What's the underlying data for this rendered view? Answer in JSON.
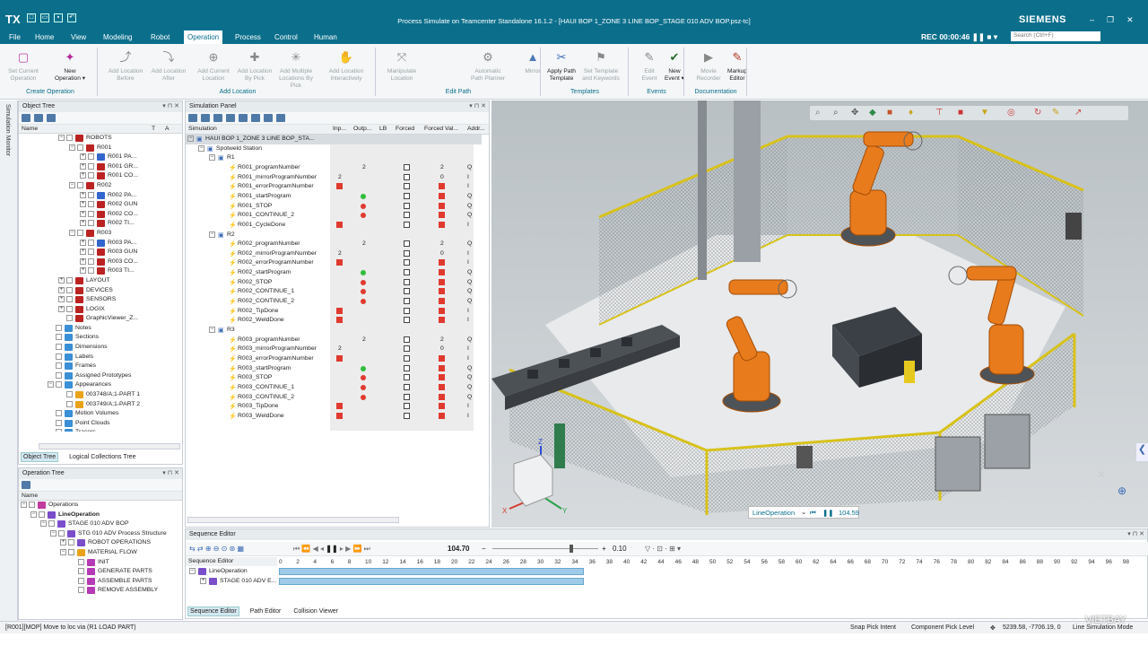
{
  "app": {
    "logo": "TX",
    "title": "Process Simulate on Teamcenter Standalone 16.1.2 - [HAUI BOP 1_ZONE 3 LINE BOP_STAGE 010 ADV BOP.psz-tc]",
    "brand": "SIEMENS",
    "rec": "REC",
    "rec_time": "00:00:46",
    "search_placeholder": "Search (Ctrl+F)"
  },
  "menu": [
    "File",
    "Home",
    "View",
    "Modeling",
    "Robot",
    "Operation",
    "Process",
    "Control",
    "Human"
  ],
  "menu_active": "Operation",
  "ribbon": {
    "buttons": [
      {
        "label": "Set Current\nOperation",
        "enabled": false
      },
      {
        "label": "New\nOperation ▾",
        "enabled": true
      },
      {
        "label": "Add Location\nBefore",
        "enabled": false
      },
      {
        "label": "Add Location\nAfter",
        "enabled": false
      },
      {
        "label": "Add Current\nLocation",
        "enabled": false
      },
      {
        "label": "Add Location\nBy Pick",
        "enabled": false
      },
      {
        "label": "Add Multiple\nLocations By Pick",
        "enabled": false
      },
      {
        "label": "Add Location\nInteractively",
        "enabled": false
      },
      {
        "label": "Manipulate\nLocation",
        "enabled": false
      },
      {
        "label": "Automatic\nPath Planner",
        "enabled": false
      },
      {
        "label": "Mirror",
        "enabled": false
      },
      {
        "label": "Apply Path\nTemplate",
        "enabled": true
      },
      {
        "label": "Set Template\nand Keywords",
        "enabled": false
      },
      {
        "label": "Edit\nEvent",
        "enabled": false
      },
      {
        "label": "New\nEvent ▾",
        "enabled": true
      },
      {
        "label": "Movie\nRecorder",
        "enabled": false
      },
      {
        "label": "Markup\nEditor",
        "enabled": true
      }
    ],
    "groups": [
      "Create Operation",
      "Add Location",
      "Edit Path",
      "Templates",
      "Events",
      "Documentation"
    ]
  },
  "side_strip": "Simulation Monitor",
  "object_tree": {
    "title": "Object Tree",
    "col_name": "Name",
    "col_t": "T",
    "col_a": "A",
    "rows": [
      {
        "d": 4,
        "t": "−",
        "label": "ROBOTS",
        "c": "#b22"
      },
      {
        "d": 5,
        "t": "−",
        "label": "R001",
        "c": "#b22"
      },
      {
        "d": 6,
        "t": "+",
        "label": "R001 PA...",
        "c": "#36c"
      },
      {
        "d": 6,
        "t": "+",
        "label": "R001 GR...",
        "c": "#b22"
      },
      {
        "d": 6,
        "t": "+",
        "label": "R001 CO...",
        "c": "#b22"
      },
      {
        "d": 5,
        "t": "−",
        "label": "R002",
        "c": "#b22"
      },
      {
        "d": 6,
        "t": "+",
        "label": "R002 PA...",
        "c": "#36c"
      },
      {
        "d": 6,
        "t": "+",
        "label": "R002 GUN",
        "c": "#b22"
      },
      {
        "d": 6,
        "t": "+",
        "label": "R002 CO...",
        "c": "#b22"
      },
      {
        "d": 6,
        "t": "+",
        "label": "R002 TI...",
        "c": "#b22"
      },
      {
        "d": 5,
        "t": "−",
        "label": "R003",
        "c": "#b22"
      },
      {
        "d": 6,
        "t": "+",
        "label": "R003 PA...",
        "c": "#36c"
      },
      {
        "d": 6,
        "t": "+",
        "label": "R003 GUN",
        "c": "#b22"
      },
      {
        "d": 6,
        "t": "+",
        "label": "R003 CO...",
        "c": "#b22"
      },
      {
        "d": 6,
        "t": "+",
        "label": "R003 TI...",
        "c": "#b22"
      },
      {
        "d": 4,
        "t": "+",
        "label": "LAYOUT",
        "c": "#b22"
      },
      {
        "d": 4,
        "t": "+",
        "label": "DEVICES",
        "c": "#b22"
      },
      {
        "d": 4,
        "t": "+",
        "label": "SENSORS",
        "c": "#b22"
      },
      {
        "d": 4,
        "t": "+",
        "label": "LOGIX",
        "c": "#b22"
      },
      {
        "d": 4,
        "t": "",
        "label": "GraphicViewer_Z...",
        "c": "#b22"
      },
      {
        "d": 3,
        "t": "",
        "label": "Notes",
        "c": "#3a8fd6"
      },
      {
        "d": 3,
        "t": "",
        "label": "Sections",
        "c": "#3a8fd6"
      },
      {
        "d": 3,
        "t": "",
        "label": "Dimensions",
        "c": "#3a8fd6"
      },
      {
        "d": 3,
        "t": "",
        "label": "Labels",
        "c": "#3a8fd6"
      },
      {
        "d": 3,
        "t": "",
        "label": "Frames",
        "c": "#3a8fd6"
      },
      {
        "d": 3,
        "t": "",
        "label": "Assigned Prototypes",
        "c": "#3a8fd6"
      },
      {
        "d": 3,
        "t": "−",
        "label": "Appearances",
        "c": "#3a8fd6"
      },
      {
        "d": 4,
        "t": "",
        "label": "003748/A;1-PART 1",
        "c": "#e9a21a"
      },
      {
        "d": 4,
        "t": "",
        "label": "003749/A;1-PART 2",
        "c": "#e9a21a"
      },
      {
        "d": 3,
        "t": "",
        "label": "Motion Volumes",
        "c": "#3a8fd6"
      },
      {
        "d": 3,
        "t": "",
        "label": "Point Clouds",
        "c": "#3a8fd6"
      },
      {
        "d": 3,
        "t": "",
        "label": "Tracers",
        "c": "#3a8fd6"
      }
    ],
    "tabs": [
      "Object Tree",
      "Logical Collections Tree"
    ]
  },
  "operation_tree": {
    "title": "Operation Tree",
    "col_name": "Name",
    "rows": [
      {
        "d": 0,
        "t": "−",
        "label": "Operations",
        "c": "#c23b9e",
        "bold": false
      },
      {
        "d": 1,
        "t": "−",
        "label": "LineOperation",
        "c": "#7a4ecb",
        "bold": true
      },
      {
        "d": 2,
        "t": "−",
        "label": "STAGE 010 ADV BOP",
        "c": "#7a4ecb",
        "bold": false
      },
      {
        "d": 3,
        "t": "−",
        "label": "STG 010 ADV Process Structure",
        "c": "#7a4ecb",
        "bold": false
      },
      {
        "d": 4,
        "t": "+",
        "label": "ROBOT OPERATIONS",
        "c": "#7a4ecb",
        "bold": false
      },
      {
        "d": 4,
        "t": "−",
        "label": "MATERIAL FLOW",
        "c": "#e9a21a",
        "bold": false
      },
      {
        "d": 5,
        "t": "",
        "label": "INIT",
        "c": "#b53ab5",
        "bold": false
      },
      {
        "d": 5,
        "t": "",
        "label": "GENERATE PARTS",
        "c": "#b53ab5",
        "bold": false
      },
      {
        "d": 5,
        "t": "",
        "label": "ASSEMBLE PARTS",
        "c": "#b53ab5",
        "bold": false
      },
      {
        "d": 5,
        "t": "",
        "label": "REMOVE ASSEMBLY",
        "c": "#b53ab5",
        "bold": false
      }
    ]
  },
  "sim_panel": {
    "title": "Simulation Panel",
    "columns": [
      "Simulation",
      "Inp...",
      "Outp...",
      "LB",
      "Forced",
      "Forced Val...",
      "Addr..."
    ],
    "rows": [
      {
        "d": 0,
        "t": "−",
        "label": "HAUI BOP 1_ZONE 3 LINE BOP_STA...",
        "k": "root"
      },
      {
        "d": 1,
        "t": "−",
        "label": "Spotweld Station",
        "k": "grp"
      },
      {
        "d": 2,
        "t": "−",
        "label": "R1",
        "k": "grp"
      },
      {
        "d": 3,
        "label": "R001_programNumber",
        "out": "2",
        "forced": true,
        "fv": "2",
        "addr": "Q"
      },
      {
        "d": 3,
        "label": "R001_mirrorProgramNumber",
        "inp": "2",
        "forced": true,
        "fv": "0",
        "addr": "I"
      },
      {
        "d": 3,
        "label": "R001_errorProgramNumber",
        "inpRed": true,
        "forced": true,
        "fvRed": true,
        "addr": "I"
      },
      {
        "d": 3,
        "label": "R001_startProgram",
        "outG": true,
        "forced": true,
        "fvRed": true,
        "addr": "Q"
      },
      {
        "d": 3,
        "label": "R001_STOP",
        "outR": true,
        "forced": true,
        "fvRed": true,
        "addr": "Q"
      },
      {
        "d": 3,
        "label": "R001_CONTINUE_2",
        "outR": true,
        "forced": true,
        "fvRed": true,
        "addr": "Q"
      },
      {
        "d": 3,
        "label": "R001_CycleDone",
        "inpRed": true,
        "forced": true,
        "fvRed": true,
        "addr": "I"
      },
      {
        "d": 2,
        "t": "−",
        "label": "R2",
        "k": "grp"
      },
      {
        "d": 3,
        "label": "R002_programNumber",
        "out": "2",
        "forced": true,
        "fv": "2",
        "addr": "Q"
      },
      {
        "d": 3,
        "label": "R002_mirrorProgramNumber",
        "inp": "2",
        "forced": true,
        "fv": "0",
        "addr": "I"
      },
      {
        "d": 3,
        "label": "R002_errorProgramNumber",
        "inpRed": true,
        "forced": true,
        "fvRed": true,
        "addr": "I"
      },
      {
        "d": 3,
        "label": "R002_startProgram",
        "outG": true,
        "forced": true,
        "fvRed": true,
        "addr": "Q"
      },
      {
        "d": 3,
        "label": "R002_STOP",
        "outR": true,
        "forced": true,
        "fvRed": true,
        "addr": "Q"
      },
      {
        "d": 3,
        "label": "R002_CONTINUE_1",
        "outR": true,
        "forced": true,
        "fvRed": true,
        "addr": "Q"
      },
      {
        "d": 3,
        "label": "R002_CONTINUE_2",
        "outR": true,
        "forced": true,
        "fvRed": true,
        "addr": "Q"
      },
      {
        "d": 3,
        "label": "R002_TipDone",
        "inpRed": true,
        "forced": true,
        "fvRed": true,
        "addr": "I"
      },
      {
        "d": 3,
        "label": "R002_WeldDone",
        "inpRed": true,
        "forced": true,
        "fvRed": true,
        "addr": "I"
      },
      {
        "d": 2,
        "t": "−",
        "label": "R3",
        "k": "grp"
      },
      {
        "d": 3,
        "label": "R003_programNumber",
        "out": "2",
        "forced": true,
        "fv": "2",
        "addr": "Q"
      },
      {
        "d": 3,
        "label": "R003_mirrorProgramNumber",
        "inp": "2",
        "forced": true,
        "fv": "0",
        "addr": "I"
      },
      {
        "d": 3,
        "label": "R003_errorProgramNumber",
        "inpRed": true,
        "forced": true,
        "fvRed": true,
        "addr": "I"
      },
      {
        "d": 3,
        "label": "R003_startProgram",
        "outG": true,
        "forced": true,
        "fvRed": true,
        "addr": "Q"
      },
      {
        "d": 3,
        "label": "R003_STOP",
        "outR": true,
        "forced": true,
        "fvRed": true,
        "addr": "Q"
      },
      {
        "d": 3,
        "label": "R003_CONTINUE_1",
        "outR": true,
        "forced": true,
        "fvRed": true,
        "addr": "Q"
      },
      {
        "d": 3,
        "label": "R003_CONTINUE_2",
        "outR": true,
        "forced": true,
        "fvRed": true,
        "addr": "Q"
      },
      {
        "d": 3,
        "label": "R003_TipDone",
        "inpRed": true,
        "forced": true,
        "fvRed": true,
        "addr": "I"
      },
      {
        "d": 3,
        "label": "R003_WeldDone",
        "inpRed": true,
        "forced": true,
        "fvRed": true,
        "addr": "I"
      }
    ]
  },
  "viewer": {
    "line_op": "LineOperation",
    "time": "104.59"
  },
  "sequence": {
    "title": "Sequence Editor",
    "current_time": "104.70",
    "step": "0.10",
    "col": "Sequence Editor",
    "rows": [
      "LineOperation",
      "STAGE 010 ADV E..."
    ],
    "ticks": [
      "0",
      "2",
      "4",
      "6",
      "8",
      "10",
      "12",
      "14",
      "16",
      "18",
      "20",
      "22",
      "24",
      "26",
      "28",
      "30",
      "32",
      "34",
      "36",
      "38",
      "40",
      "42",
      "44",
      "46",
      "48",
      "50",
      "52",
      "54",
      "56",
      "58",
      "60",
      "62",
      "64",
      "66",
      "68",
      "70",
      "72",
      "74",
      "76",
      "78",
      "80",
      "82",
      "84",
      "86",
      "88",
      "90",
      "92",
      "94",
      "96",
      "98"
    ],
    "tabs": [
      "Sequence Editor",
      "Path Editor",
      "Collision Viewer"
    ]
  },
  "status": {
    "message": "[R001][MOP] Move to loc via (R1 LOAD PART)",
    "snap": "Snap Pick Intent",
    "pick": "Component Pick Level",
    "coords": "5239.58, -7706.19, 0",
    "mode": "Line Simulation Mode",
    "watermark": "VIETBAY"
  }
}
